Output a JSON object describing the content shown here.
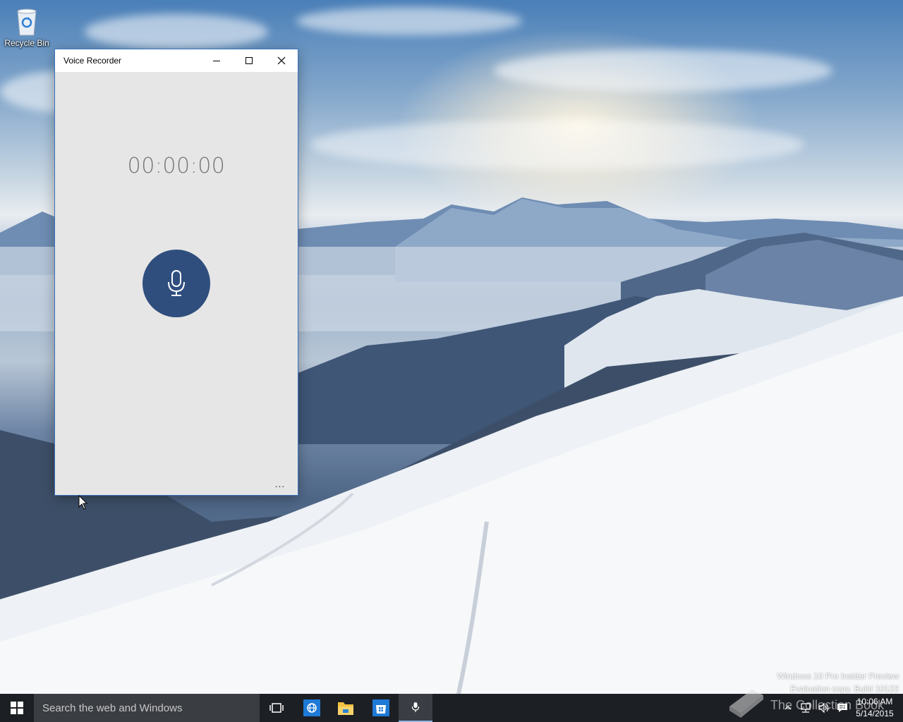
{
  "desktop": {
    "icons": [
      {
        "label": "Recycle Bin",
        "icon": "recycle-bin-icon"
      }
    ],
    "watermark": {
      "line1": "Windows 10 Pro Insider Preview",
      "line2": "Evaluation copy. Build 10122"
    },
    "overlay_text": "The Collection Book"
  },
  "window": {
    "title": "Voice Recorder",
    "controls": {
      "minimize": "minimize-icon",
      "maximize": "maximize-icon",
      "close": "close-icon"
    },
    "timer": "00:00:00",
    "record_button_icon": "microphone-icon",
    "more_label": "...",
    "accent_color": "#2f4e7e"
  },
  "taskbar": {
    "search_placeholder": "Search the web and Windows",
    "apps": [
      "task-view-icon",
      "internet-explorer-icon",
      "file-explorer-icon",
      "store-icon",
      "voice-recorder-icon"
    ],
    "tray_icons": [
      "chevron-up-icon",
      "network-icon",
      "volume-icon",
      "action-center-icon"
    ],
    "time": "10:06 AM",
    "date": "5/14/2015"
  }
}
